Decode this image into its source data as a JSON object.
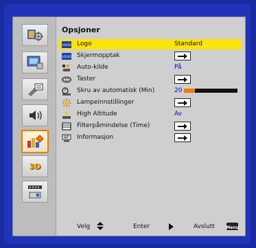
{
  "menu": {
    "title": "Opsjoner",
    "items": [
      {
        "label": "Logo",
        "value": "Standard",
        "icon": "logo-icon",
        "control": "value"
      },
      {
        "label": "Skjermopptak",
        "icon": "logo-capture-icon",
        "control": "enter"
      },
      {
        "label": "Auto-kilde",
        "value": "På",
        "icon": "auto-source-icon",
        "control": "value"
      },
      {
        "label": "Taster",
        "icon": "keypad-icon",
        "control": "enter"
      },
      {
        "label": "Skru av automatisk (Min)",
        "value": "20",
        "level": 0.2,
        "icon": "auto-power-off-icon",
        "control": "slider"
      },
      {
        "label": "Lampeinnstillinger",
        "icon": "lamp-icon",
        "control": "enter"
      },
      {
        "label": "High Altitude",
        "value": "Av",
        "icon": "high-altitude-icon",
        "control": "value"
      },
      {
        "label": "Filterpåmindelse (Time)",
        "icon": "filter-reminder-icon",
        "control": "enter"
      },
      {
        "label": "Informasjon",
        "icon": "information-icon",
        "control": "enter"
      }
    ]
  },
  "sidebar": {
    "tabs": [
      {
        "icon": "image-tab-icon"
      },
      {
        "icon": "screen-tab-icon"
      },
      {
        "icon": "settings-tab-icon"
      },
      {
        "icon": "volume-tab-icon"
      },
      {
        "icon": "options-tab-icon",
        "active": true
      },
      {
        "label": "3D",
        "icon": "3d-tab-icon"
      },
      {
        "icon": "lan-tab-icon"
      }
    ]
  },
  "footer": {
    "select_label": "Velg",
    "enter_label": "Enter",
    "exit_label": "Avslutt",
    "menu_key": "Menu"
  },
  "colors": {
    "highlight": "#fbe40a",
    "accent": "#f07c00",
    "value_blue": "#0000cc"
  }
}
